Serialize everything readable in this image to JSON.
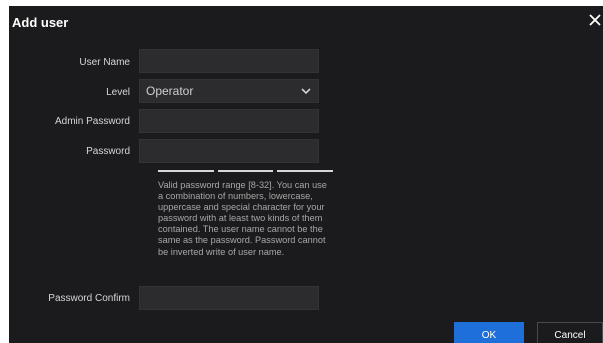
{
  "dialog": {
    "title": "Add user",
    "close_icon": "close-icon"
  },
  "form": {
    "user_name": {
      "label": "User Name",
      "value": ""
    },
    "level": {
      "label": "Level",
      "selected": "Operator",
      "icon": "chevron-down-icon"
    },
    "admin_password": {
      "label": "Admin Password",
      "value": ""
    },
    "password": {
      "label": "Password",
      "value": ""
    },
    "password_strength_segments": 3,
    "password_hint": "Valid password range [8-32]. You can use a combination of numbers, lowercase, uppercase and special character for your password with at least two kinds of them contained. The user name cannot be the same as the password. Password cannot be inverted write of user name.",
    "password_confirm": {
      "label": "Password Confirm",
      "value": ""
    }
  },
  "buttons": {
    "ok_label": "OK",
    "cancel_label": "Cancel"
  },
  "colors": {
    "dialog_bg": "#1b1b1d",
    "field_bg": "#2c2c2f",
    "primary": "#1e6fd9"
  }
}
